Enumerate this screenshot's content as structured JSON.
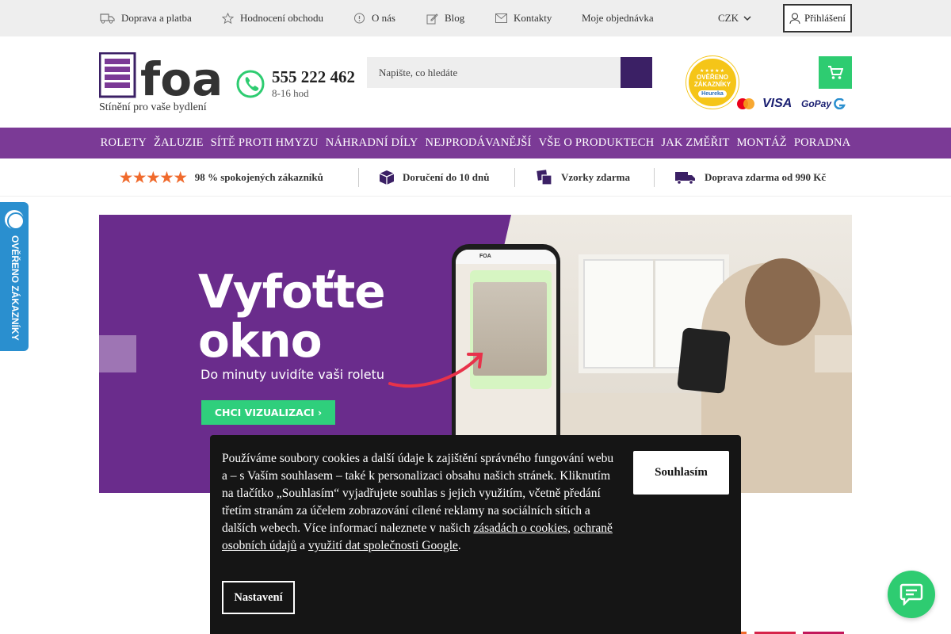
{
  "topbar": {
    "shipping": "Doprava a platba",
    "reviews": "Hodnocení obchodu",
    "about": "O nás",
    "blog": "Blog",
    "contacts": "Kontakty",
    "orders": "Moje objednávka",
    "currency": "CZK",
    "login": "Přihlášení"
  },
  "header": {
    "logo_text": "foa",
    "tagline": "Stínění pro vaše bydlení",
    "phone": "555 222 462",
    "hours": "8-16 hod",
    "search_placeholder": "Napište, co hledáte",
    "badge_line1": "OVĚŘENO",
    "badge_line2": "ZÁKAZNÍKY",
    "badge_brand": "Heureka",
    "visa": "VISA",
    "gopay": "GoPay"
  },
  "nav": [
    "ROLETY",
    "ŽALUZIE",
    "SÍTĚ PROTI HMYZU",
    "NÁHRADNÍ DÍLY",
    "NEJPRODÁVANĚJŠÍ",
    "VŠE O PRODUKTECH",
    "JAK ZMĚŘIT",
    "MONTÁŽ",
    "PORADNA"
  ],
  "benefits": {
    "satisfied": "98 % spokojených zákazníků",
    "delivery": "Doručení do 10 dnů",
    "samples": "Vzorky zdarma",
    "free_shipping": "Doprava zdarma od 990 Kč"
  },
  "side_tab": "OVĚŘENO ZÁKAZNÍKY",
  "hero": {
    "title_line1": "Vyfoťte",
    "title_line2": "okno",
    "subtitle": "Do minuty uvidíte vaši roletu",
    "cta": "CHCI VIZUALIZACI  ›",
    "phone_app_label": "FOA"
  },
  "cookie": {
    "text_before": "Používáme soubory cookies a další údaje k zajištění správného fungování webu a – s Vaším souhlasem – také k personalizaci obsahu našich stránek. Kliknutím na tlačítko „Souhlasím“ vyjadřujete souhlas s jejich využitím, včetně předání třetím stranám za účelem zobrazování cílené reklamy na sociálních sítích a dalších webech. Více informací naleznete v našich ",
    "link_cookies": "zásadách o cookies",
    "sep1": ", ",
    "link_privacy": "ochraně osobních údajů",
    "sep2": " a ",
    "link_google": "využití dat společnosti Google",
    "end": ".",
    "agree": "Souhlasím",
    "settings": "Nastavení"
  },
  "colors": {
    "brand_purple": "#7b3a96",
    "dark_purple": "#3b2065",
    "green": "#2ecc71",
    "star_orange": "#f06a2c"
  }
}
